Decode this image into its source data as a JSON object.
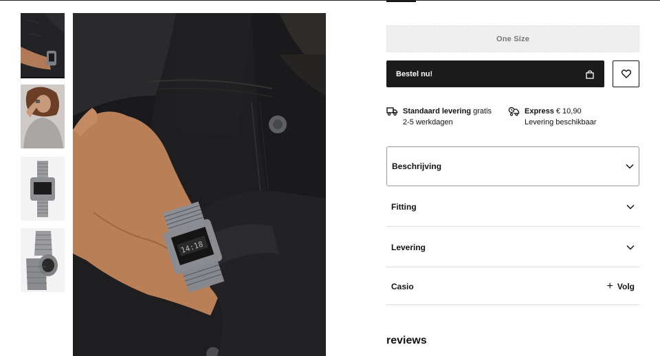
{
  "size": {
    "value": "One Size"
  },
  "order": {
    "label": "Bestel nu!",
    "icon": "shopping-bag-icon"
  },
  "wishlist": {
    "icon": "heart-icon"
  },
  "shipping": {
    "standard": {
      "title": "Standaard levering",
      "price": "gratis",
      "detail": "2-5 werkdagen",
      "icon": "truck-icon"
    },
    "express": {
      "title": "Express",
      "price": "€ 10,90",
      "detail": "Levering beschikbaar",
      "icon": "express-truck-icon"
    }
  },
  "accordion": [
    {
      "label": "Beschrijving"
    },
    {
      "label": "Fitting"
    },
    {
      "label": "Levering"
    }
  ],
  "brand": {
    "name": "Casio",
    "follow_label": "Volg",
    "follow_icon": "plus-icon"
  },
  "reviews": {
    "heading": "reviews"
  },
  "colors": {
    "button_bg": "#1b1b1b",
    "size_bg": "#efefef",
    "divider": "#dcdcdc"
  }
}
